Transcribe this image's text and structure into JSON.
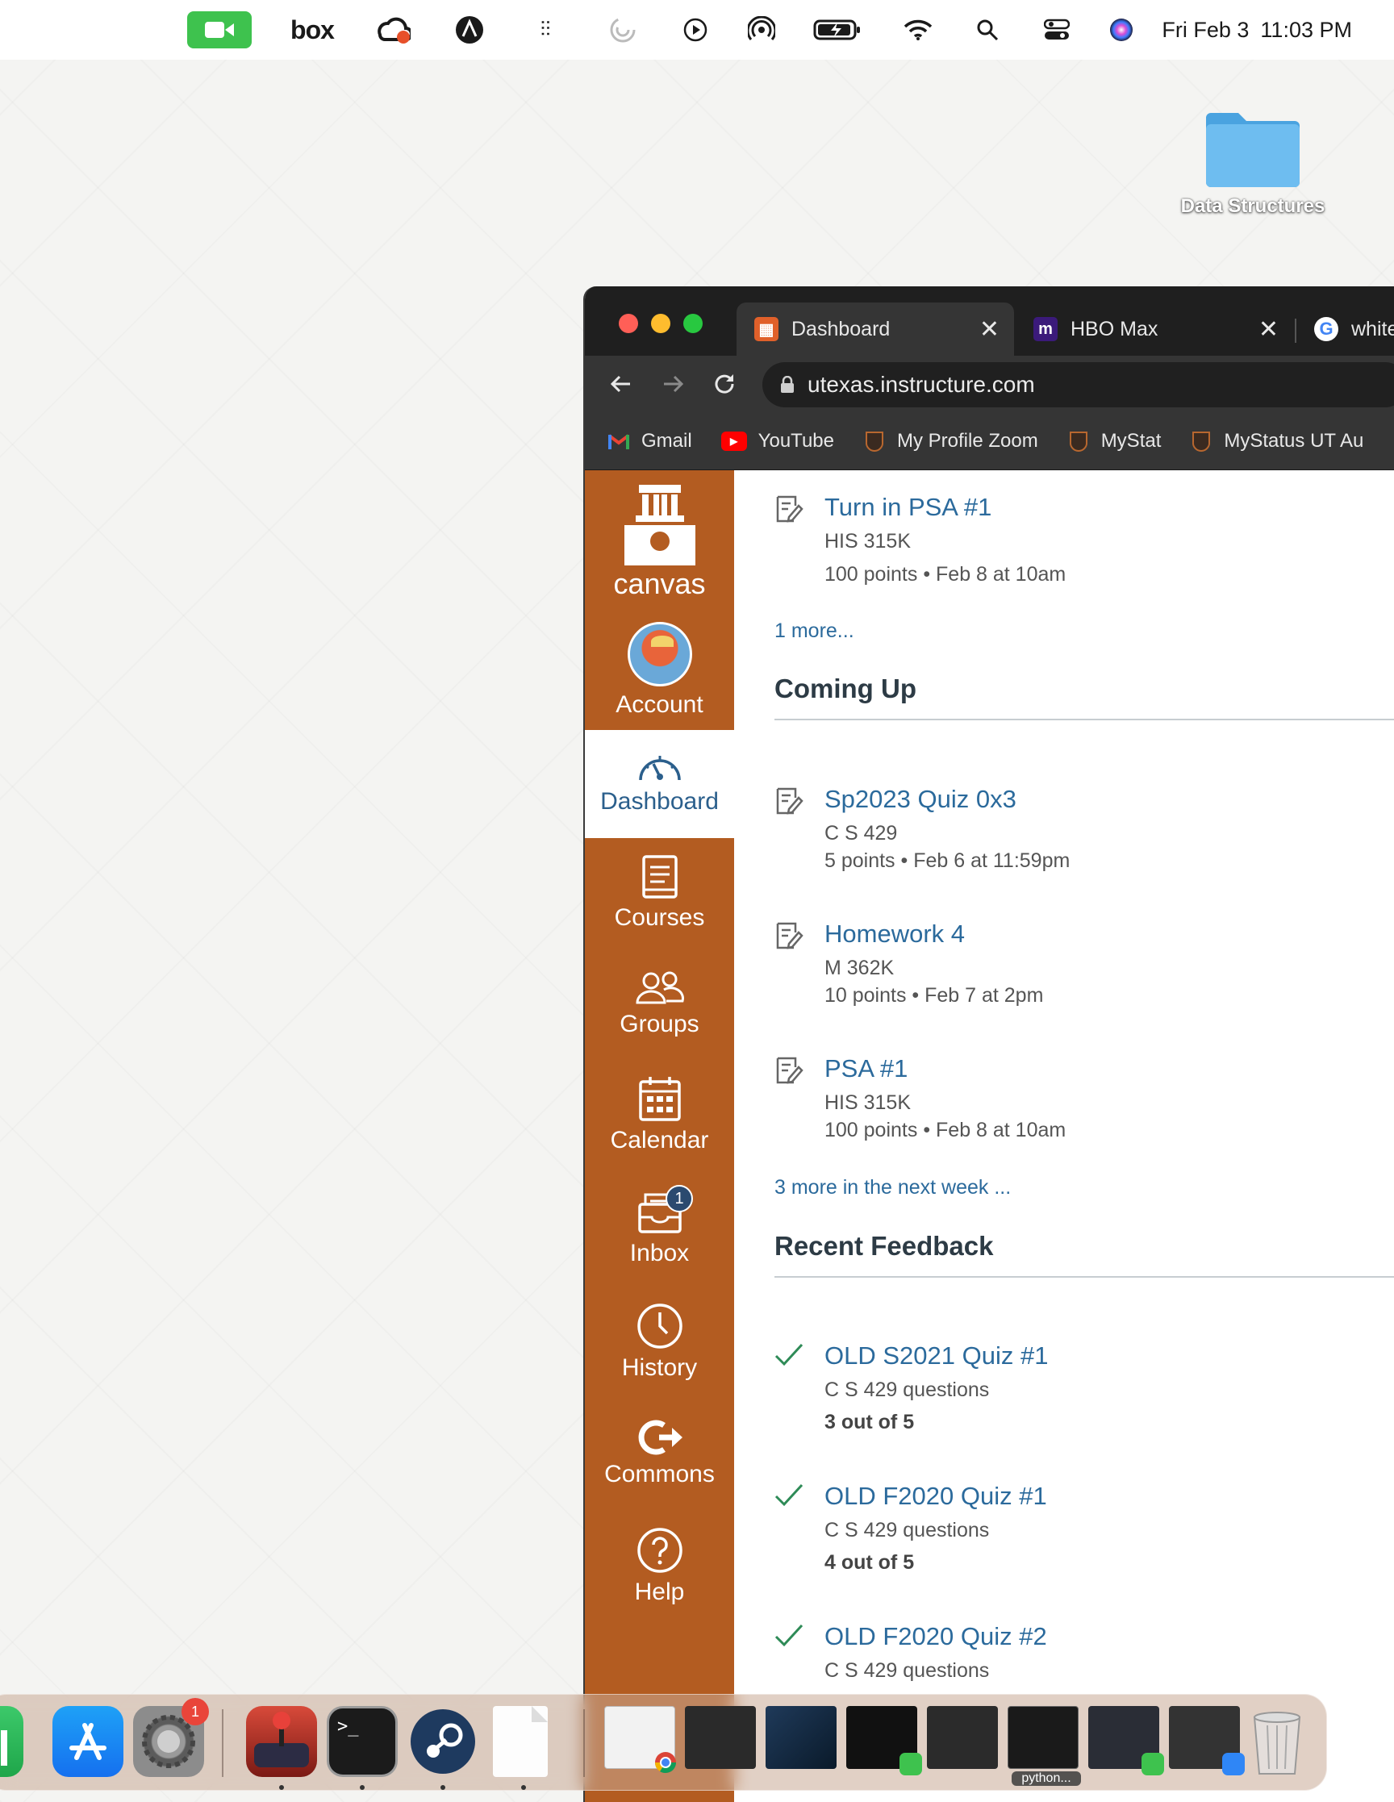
{
  "menubar": {
    "date": "Fri Feb 3",
    "time": "11:03 PM",
    "box_label": "box",
    "icons": [
      "facetime-camera-icon",
      "box-icon",
      "creative-cloud-icon",
      "clipper-icon",
      "airpods-icon",
      "loading-icon",
      "play-icon",
      "airdrop-icon",
      "battery-icon",
      "wifi-icon",
      "spotlight-search-icon",
      "control-center-icon",
      "siri-icon"
    ]
  },
  "desktop": {
    "folder_label": "Data Structures"
  },
  "browser": {
    "tabs": [
      {
        "title": "Dashboard",
        "active": true
      },
      {
        "title": "HBO Max",
        "active": false
      },
      {
        "title": "white",
        "active": false
      }
    ],
    "url": "utexas.instructure.com",
    "bookmarks": [
      "Gmail",
      "YouTube",
      "My Profile Zoom",
      "MyStat",
      "MyStatus UT Au"
    ]
  },
  "canvas_nav": {
    "logo_text": "canvas",
    "items": [
      {
        "label": "Account",
        "icon": "avatar-icon"
      },
      {
        "label": "Dashboard",
        "icon": "dashboard-gauge-icon",
        "active": true
      },
      {
        "label": "Courses",
        "icon": "book-icon"
      },
      {
        "label": "Groups",
        "icon": "groups-icon"
      },
      {
        "label": "Calendar",
        "icon": "calendar-icon"
      },
      {
        "label": "Inbox",
        "icon": "inbox-icon",
        "badge": "1"
      },
      {
        "label": "History",
        "icon": "clock-icon"
      },
      {
        "label": "Commons",
        "icon": "commons-icon"
      },
      {
        "label": "Help",
        "icon": "help-icon"
      }
    ]
  },
  "todo": {
    "first_item": {
      "title": "Turn in PSA #1",
      "course": "HIS 315K",
      "meta": "100 points • Feb 8 at 10am"
    },
    "more_link": "1 more..."
  },
  "coming_up": {
    "heading": "Coming Up",
    "items": [
      {
        "title": "Sp2023 Quiz 0x3",
        "course": "C S 429",
        "meta": "5 points • Feb 6 at 11:59pm"
      },
      {
        "title": "Homework 4",
        "course": "M 362K",
        "meta": "10 points • Feb 7 at 2pm"
      },
      {
        "title": "PSA #1",
        "course": "HIS 315K",
        "meta": "100 points • Feb 8 at 10am"
      }
    ],
    "more_link": "3 more in the next week ..."
  },
  "recent_feedback": {
    "heading": "Recent Feedback",
    "items": [
      {
        "title": "OLD S2021 Quiz #1",
        "course": "C S 429 questions",
        "score": "3 out of 5"
      },
      {
        "title": "OLD F2020 Quiz #1",
        "course": "C S 429 questions",
        "score": "4 out of 5"
      },
      {
        "title": "OLD F2020 Quiz #2",
        "course": "C S 429 questions",
        "score": ""
      }
    ]
  },
  "dock": {
    "settings_badge": "1",
    "window_label": "python..."
  }
}
